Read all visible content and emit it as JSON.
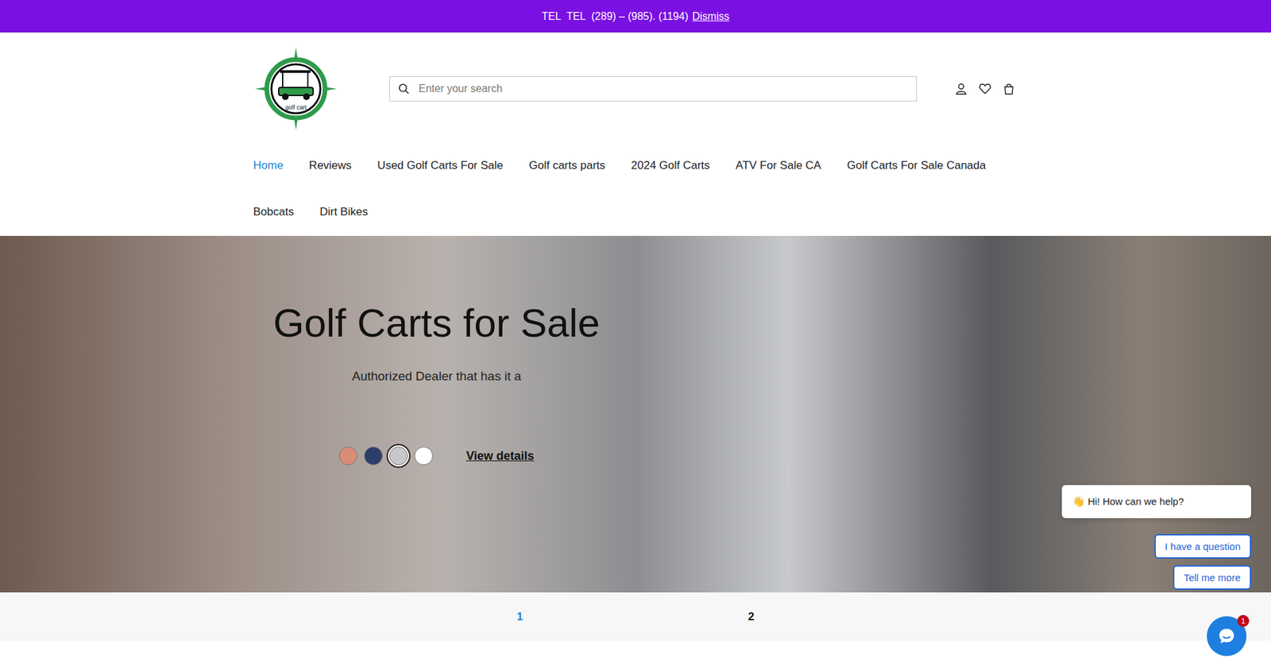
{
  "announcement": {
    "text": "TEL  TEL  (289) – (985). (1194)",
    "action": "Dismiss"
  },
  "logo": {
    "text": "golf cart"
  },
  "search": {
    "placeholder": "Enter your search"
  },
  "nav": [
    {
      "label": "Home",
      "selected": true
    },
    {
      "label": "Reviews",
      "selected": false
    },
    {
      "label": "Used Golf Carts For Sale",
      "selected": false
    },
    {
      "label": "Golf carts parts",
      "selected": false
    },
    {
      "label": "2024 Golf Carts",
      "selected": false
    },
    {
      "label": "ATV For Sale CA",
      "selected": false
    },
    {
      "label": "Golf Carts For Sale Canada",
      "selected": false
    },
    {
      "label": "Bobcats",
      "selected": false
    },
    {
      "label": "Dirt Bikes",
      "selected": false
    }
  ],
  "hero": {
    "title": "Golf Carts for Sale",
    "subtitle": "Authorized Dealer that has it a",
    "swatches": [
      {
        "color": "#d98c78",
        "selected": false
      },
      {
        "color": "#2d3e6b",
        "selected": false
      },
      {
        "color": "#c8c8c8",
        "selected": true
      },
      {
        "color": "#ffffff",
        "selected": false
      }
    ],
    "link": "View details"
  },
  "pagination": [
    {
      "label": "1",
      "selected": true
    },
    {
      "label": "2",
      "selected": false
    }
  ],
  "chat": {
    "greeting": "👋 Hi! How can we help?",
    "options": [
      "I have a question",
      "Tell me more"
    ],
    "badge": "1"
  }
}
